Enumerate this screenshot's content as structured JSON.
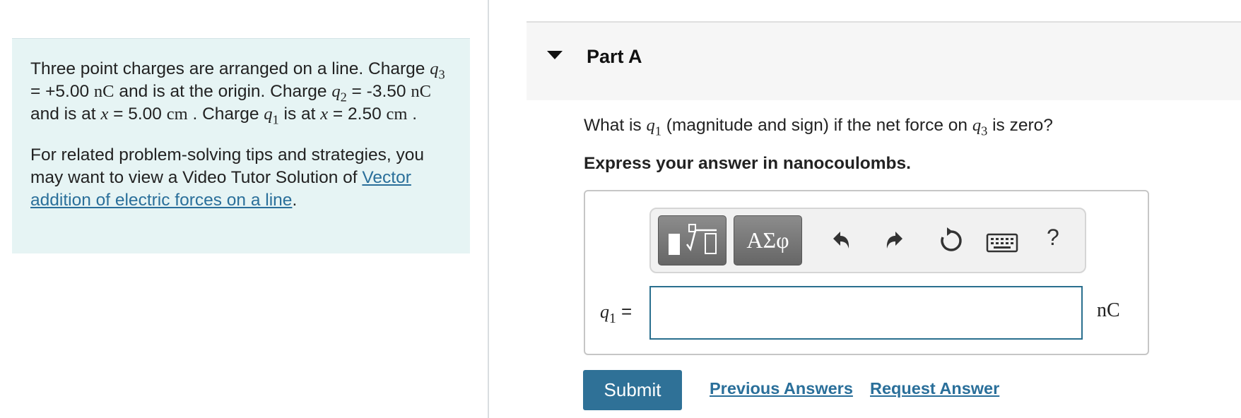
{
  "problem": {
    "p1": {
      "t1": "Three point charges are arranged on a line. Charge ",
      "v1": "q",
      "s1": "3",
      "t2": " = +5.00 ",
      "u1": "nC",
      "t3": " and is at the origin. Charge ",
      "v2": "q",
      "s2": "2",
      "t4": " = -3.50 ",
      "u2": "nC",
      "t5": " and is at ",
      "v3": "x",
      "t6": " = 5.00 ",
      "u3": "cm",
      "t7": " . Charge ",
      "v4": "q",
      "s4": "1",
      "t8": " is at ",
      "v5": "x",
      "t9": " = 2.50 ",
      "u4": "cm",
      "t10": " ."
    },
    "p2": {
      "text": "For related problem-solving tips and strategies, you may want to view a Video Tutor Solution of ",
      "link": "Vector addition of electric forces on a line",
      "end": "."
    }
  },
  "part": {
    "title": "Part A"
  },
  "question": {
    "t1": "What is ",
    "v1": "q",
    "s1": "1",
    "t2": " (magnitude and sign) if the net force on ",
    "v2": "q",
    "s2": "3",
    "t3": " is zero?"
  },
  "instruction": "Express your answer in nanocoulombs.",
  "toolbar": {
    "symbols_label": "ΑΣφ",
    "help_label": "?",
    "icons": [
      "templates-icon",
      "undo-icon",
      "redo-icon",
      "reset-icon",
      "keyboard-icon",
      "help-icon"
    ]
  },
  "answer": {
    "var": "q",
    "sub": "1",
    "eq": " =",
    "value": "",
    "unit": "nC"
  },
  "footer": {
    "submit_label": "Submit",
    "previous_answers": "Previous Answers",
    "request_answer": "Request Answer"
  },
  "colors": {
    "panel_bg": "#e6f4f4",
    "link": "#2a6f9a",
    "submit_bg": "#2f7197",
    "input_border": "#2a6f8e"
  }
}
